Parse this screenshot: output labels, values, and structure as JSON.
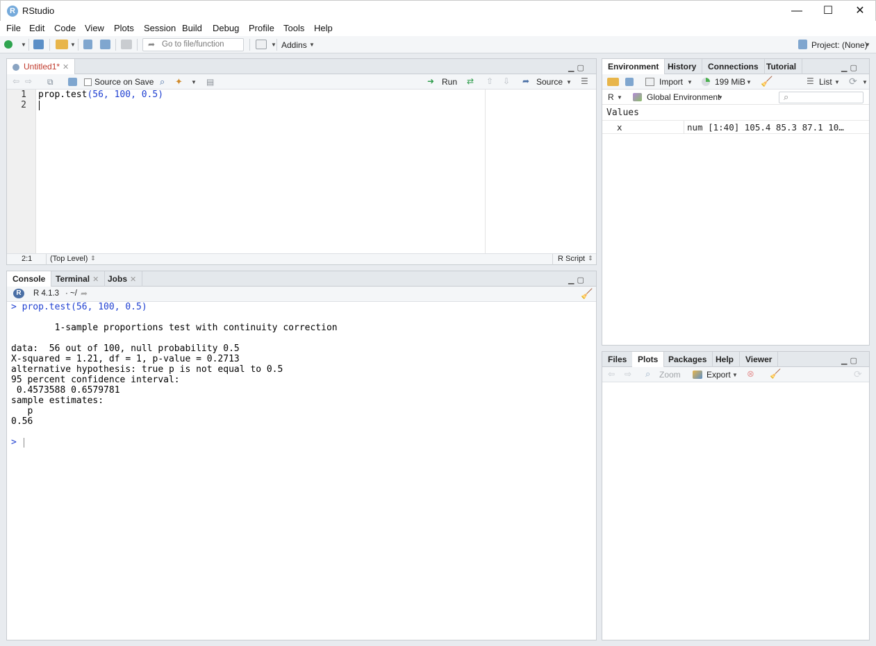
{
  "window": {
    "title": "RStudio",
    "logo_letter": "R",
    "minimize": "—",
    "maximize": "☐",
    "close": "✕"
  },
  "menu": [
    "File",
    "Edit",
    "Code",
    "View",
    "Plots",
    "Session",
    "Build",
    "Debug",
    "Profile",
    "Tools",
    "Help"
  ],
  "toolbar": {
    "goto_placeholder": "Go to file/function",
    "addins": "Addins",
    "project": "Project: (None)"
  },
  "editor": {
    "tab": "Untitled1*",
    "source_on_save": "Source on Save",
    "run": "Run",
    "source": "Source",
    "line_numbers": [
      "1",
      "2"
    ],
    "code_fn": "prop.test",
    "code_args": "(56, 100, 0.5)",
    "status_pos": "2:1",
    "status_scope": "(Top Level)",
    "status_type": "R Script"
  },
  "console": {
    "tabs": [
      "Console",
      "Terminal",
      "Jobs"
    ],
    "r_version": "R 4.1.3",
    "wd": "· ~/",
    "prompt": ">",
    "lines": [
      {
        "text": "> prop.test(56, 100, 0.5)",
        "input": true
      },
      {
        "text": "",
        "input": false
      },
      {
        "text": "        1-sample proportions test with continuity correction",
        "input": false
      },
      {
        "text": "",
        "input": false
      },
      {
        "text": "data:  56 out of 100, null probability 0.5",
        "input": false
      },
      {
        "text": "X-squared = 1.21, df = 1, p-value = 0.2713",
        "input": false
      },
      {
        "text": "alternative hypothesis: true p is not equal to 0.5",
        "input": false
      },
      {
        "text": "95 percent confidence interval:",
        "input": false
      },
      {
        "text": " 0.4573588 0.6579781",
        "input": false
      },
      {
        "text": "sample estimates:",
        "input": false
      },
      {
        "text": "   p",
        "input": false
      },
      {
        "text": "0.56",
        "input": false
      },
      {
        "text": "",
        "input": false
      },
      {
        "text": "> ",
        "input": true
      }
    ]
  },
  "environment": {
    "tabs": [
      "Environment",
      "History",
      "Connections",
      "Tutorial"
    ],
    "import": "Import",
    "memory": "199 MiB",
    "view_mode": "List",
    "lang": "R",
    "scope": "Global Environment",
    "section": "Values",
    "rows": [
      {
        "name": "x",
        "value": "num [1:40] 105.4 85.3 87.1 10…"
      }
    ]
  },
  "files": {
    "tabs": [
      "Files",
      "Plots",
      "Packages",
      "Help",
      "Viewer"
    ],
    "zoom": "Zoom",
    "export": "Export"
  }
}
